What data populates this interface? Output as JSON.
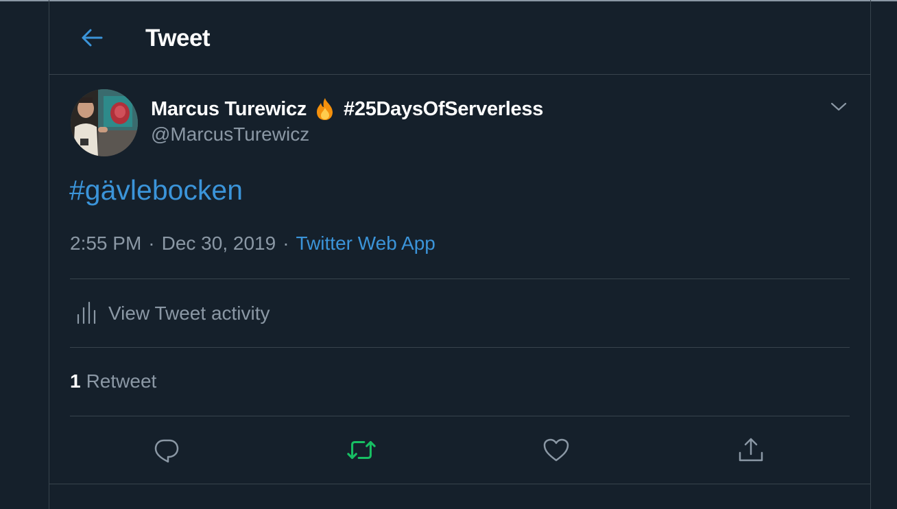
{
  "header": {
    "title": "Tweet",
    "back_icon": "arrow-left-icon"
  },
  "author": {
    "display_name": "Marcus Turewicz",
    "name_emoji": "fire-icon",
    "name_hashtag": "#25DaysOfServerless",
    "handle": "@MarcusTurewicz"
  },
  "tweet": {
    "text": "#gävlebocken",
    "time": "2:55 PM",
    "date": "Dec 30, 2019",
    "separator": "·",
    "source": "Twitter Web App"
  },
  "activity": {
    "label": "View Tweet activity",
    "icon": "bar-chart-icon"
  },
  "stats": {
    "retweet_count": "1",
    "retweet_label": "Retweet"
  },
  "actions": [
    {
      "name": "reply",
      "icon": "reply-icon"
    },
    {
      "name": "retweet",
      "icon": "retweet-icon"
    },
    {
      "name": "like",
      "icon": "heart-icon"
    },
    {
      "name": "share",
      "icon": "share-icon"
    }
  ],
  "colors": {
    "background": "#15202b",
    "accent": "#3b94d9",
    "retweet_active": "#17bf63",
    "secondary_text": "#8b98a5",
    "border": "#38444d"
  }
}
